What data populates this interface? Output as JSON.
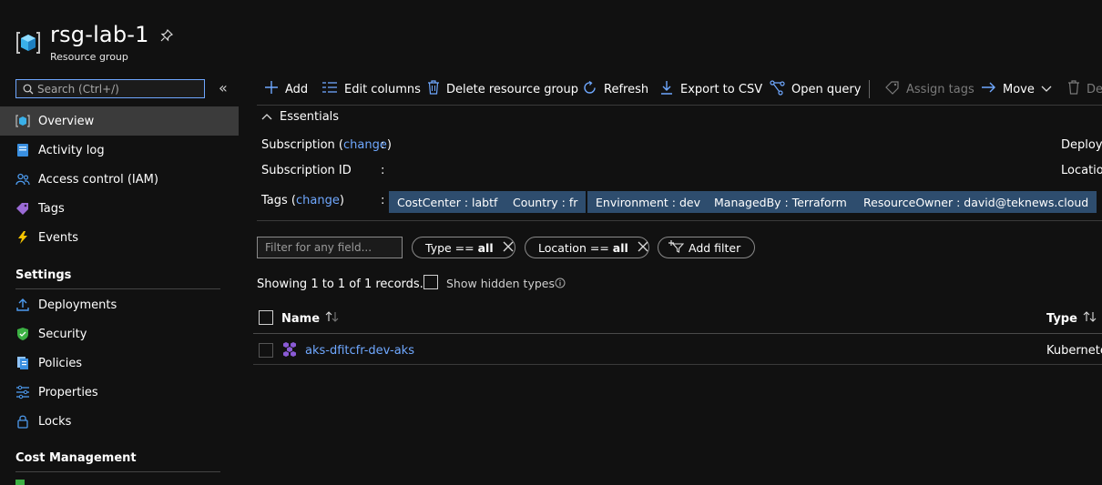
{
  "header": {
    "title": "rsg-lab-1",
    "subtitle": "Resource group"
  },
  "sidebar": {
    "search_placeholder": "Search (Ctrl+/)",
    "collapse_glyph": "«",
    "items": [
      {
        "label": "Overview",
        "icon": "resource-group-icon",
        "active": true
      },
      {
        "label": "Activity log",
        "icon": "activity-log-icon"
      },
      {
        "label": "Access control (IAM)",
        "icon": "people-icon"
      },
      {
        "label": "Tags",
        "icon": "tag-icon"
      },
      {
        "label": "Events",
        "icon": "lightning-icon"
      }
    ],
    "settings_title": "Settings",
    "settings_items": [
      {
        "label": "Deployments",
        "icon": "upload-icon"
      },
      {
        "label": "Security",
        "icon": "shield-icon"
      },
      {
        "label": "Policies",
        "icon": "policy-icon"
      },
      {
        "label": "Properties",
        "icon": "sliders-icon"
      },
      {
        "label": "Locks",
        "icon": "lock-icon"
      }
    ],
    "cost_title": "Cost Management"
  },
  "toolbar": {
    "add": "Add",
    "edit_columns": "Edit columns",
    "delete_rg": "Delete resource group",
    "refresh": "Refresh",
    "export_csv": "Export to CSV",
    "open_query": "Open query",
    "assign_tags": "Assign tags",
    "move": "Move",
    "delete": "De"
  },
  "essentials": {
    "title": "Essentials",
    "subscription_label": "Subscription (",
    "change": "change",
    "close_paren": ")",
    "colon": ":",
    "subscription_id_label": "Subscription ID",
    "tags_label": "Tags (",
    "deployments_label": "Deploym",
    "location_label": "Locatio",
    "tags": [
      "CostCenter : labtf",
      "Country : fr",
      "Environment : dev",
      "ManagedBy : Terraform",
      "ResourceOwner : david@teknews.cloud"
    ]
  },
  "filters": {
    "placeholder": "Filter for any field...",
    "type_prefix": "Type == ",
    "location_prefix": "Location == ",
    "all": "all",
    "add_filter": "Add filter"
  },
  "records": {
    "showing": "Showing 1 to 1 of 1 records.",
    "show_hidden": "Show hidden types"
  },
  "table": {
    "col_name": "Name",
    "col_type": "Type",
    "rows": [
      {
        "name": "aks-dfitcfr-dev-aks",
        "type": "Kubernete"
      }
    ]
  },
  "colors": {
    "accent": "#6fa8ff",
    "tag_bg": "#2e4d6e",
    "active_nav": "#3b3b3b",
    "background": "#111111"
  }
}
